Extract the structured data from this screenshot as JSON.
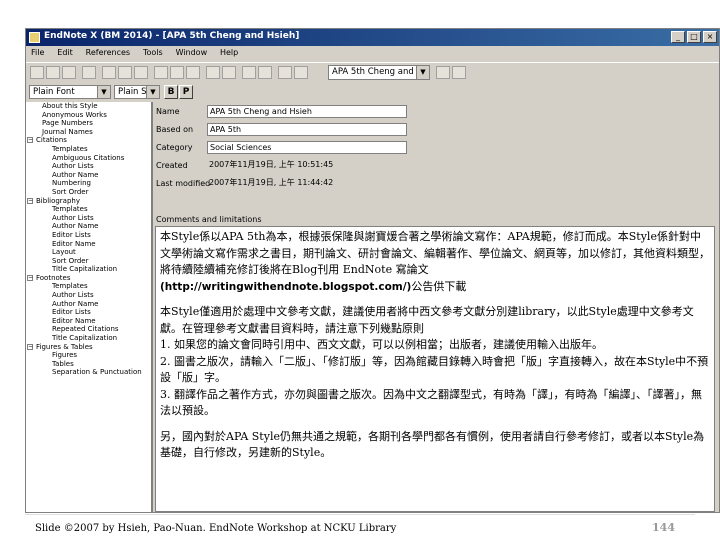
{
  "window": {
    "title": "EndNote X (BM 2014) - [APA 5th Cheng and Hsieh]"
  },
  "menu": [
    "File",
    "Edit",
    "References",
    "Tools",
    "Window",
    "Help"
  ],
  "toolbar": {
    "style_select": "APA 5th Cheng and"
  },
  "format_bar": {
    "font": "Plain Font",
    "size": "Plain Size",
    "bold": "B",
    "plain": "P"
  },
  "tree": [
    {
      "label": "About this Style",
      "level": 1
    },
    {
      "label": "Anonymous Works",
      "level": 1
    },
    {
      "label": "Page Numbers",
      "level": 1
    },
    {
      "label": "Journal Names",
      "level": 1
    },
    {
      "label": "Citations",
      "level": 0
    },
    {
      "label": "Templates",
      "level": 2
    },
    {
      "label": "Ambiguous Citations",
      "level": 2
    },
    {
      "label": "Author Lists",
      "level": 2
    },
    {
      "label": "Author Name",
      "level": 2
    },
    {
      "label": "Numbering",
      "level": 2
    },
    {
      "label": "Sort Order",
      "level": 2
    },
    {
      "label": "Bibliography",
      "level": 0
    },
    {
      "label": "Templates",
      "level": 2
    },
    {
      "label": "Author Lists",
      "level": 2
    },
    {
      "label": "Author Name",
      "level": 2
    },
    {
      "label": "Editor Lists",
      "level": 2
    },
    {
      "label": "Editor Name",
      "level": 2
    },
    {
      "label": "Layout",
      "level": 2
    },
    {
      "label": "Sort Order",
      "level": 2
    },
    {
      "label": "Title Capitalization",
      "level": 2
    },
    {
      "label": "Footnotes",
      "level": 0
    },
    {
      "label": "Templates",
      "level": 2
    },
    {
      "label": "Author Lists",
      "level": 2
    },
    {
      "label": "Author Name",
      "level": 2
    },
    {
      "label": "Editor Lists",
      "level": 2
    },
    {
      "label": "Editor Name",
      "level": 2
    },
    {
      "label": "Repeated Citations",
      "level": 2
    },
    {
      "label": "Title Capitalization",
      "level": 2
    },
    {
      "label": "Figures & Tables",
      "level": 0
    },
    {
      "label": "Figures",
      "level": 2
    },
    {
      "label": "Tables",
      "level": 2
    },
    {
      "label": "Separation & Punctuation",
      "level": 2
    }
  ],
  "fields": [
    {
      "label": "Name",
      "value": "APA 5th Cheng and Hsieh",
      "box": true
    },
    {
      "label": "Based on",
      "value": "APA 5th",
      "box": true
    },
    {
      "label": "Category",
      "value": "Social Sciences",
      "box": true
    },
    {
      "label": "Created",
      "value": "2007年11月19日, 上午 10:51:45",
      "box": false
    },
    {
      "label": "Last modified",
      "value": "2007年11月19日, 上午 11:44:42",
      "box": false
    }
  ],
  "comments_label": "Comments and limitations",
  "comments": {
    "p1": "本Style係以APA 5th為本，根據張保隆與謝寶煖合著之學術論文寫作：APA規範，修訂而成。本Style係針對中文學術論文寫作需求之書目，期刊論文、研討會論文、編輯著作、學位論文、網頁等，加以修訂，其他資料類型，將待續陸續補充修訂後將在Blog刊用 EndNote 寫論文",
    "url": "(http://writingwithendnote.blogspot.com/)",
    "p1_end": "公告供下載",
    "p2": "本Style僅適用於處理中文參考文獻，建議使用者將中西文參考文獻分別建library，以此Style處理中文參考文獻。在管理參考文獻書目資料時，請注意下列幾點原則",
    "items": [
      "1. 如果您的論文會同時引用中、西文文獻，可以以例相當；出版者，建議使用輸入出版年。",
      "2. 圖書之版次，請輸入「二版」、「修訂版」等，因為館藏目錄轉入時會把「版」字直接轉入，故在本Style中不預設「版」字。",
      "3. 翻譯作品之著作方式，亦勿與圖書之版次。因為中文之翻譯型式，有時為「譯」，有時為「編譯」、「譯著」，無法以預設。"
    ],
    "p3": "另，國內對於APA Style仍無共通之規範，各期刊各學門都各有慣例，使用者請自行參考修訂，或者以本Style為基礎，自行修改，另建新的Style。"
  },
  "footer": {
    "credit": "Slide ©2007  by Hsieh, Pao-Nuan.  EndNote Workshop at NCKU Library",
    "page": "144"
  }
}
